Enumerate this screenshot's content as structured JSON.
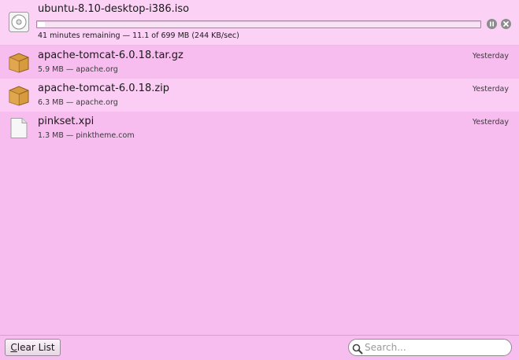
{
  "downloads": [
    {
      "name": "ubuntu-8.10-desktop-i386.iso",
      "status": "41 minutes remaining — 11.1 of 699 MB (244 KB/sec)",
      "progress": 0.016,
      "icon": "disc-icon",
      "state": "downloading"
    },
    {
      "name": "apache-tomcat-6.0.18.tar.gz",
      "status": "5.9 MB — apache.org",
      "when": "Yesterday",
      "icon": "package-icon"
    },
    {
      "name": "apache-tomcat-6.0.18.zip",
      "status": "6.3 MB — apache.org",
      "when": "Yesterday",
      "icon": "package-icon"
    },
    {
      "name": "pinkset.xpi",
      "status": "1.3 MB — pinktheme.com",
      "when": "Yesterday",
      "icon": "document-icon"
    }
  ],
  "footer": {
    "clear_list_mnemonic": "C",
    "clear_list_rest": "lear List",
    "search_placeholder": "Search..."
  },
  "colors": {
    "background": "#f7bdef",
    "active_row": "#fbd2f5",
    "alt_row": "#fbcdf5"
  }
}
